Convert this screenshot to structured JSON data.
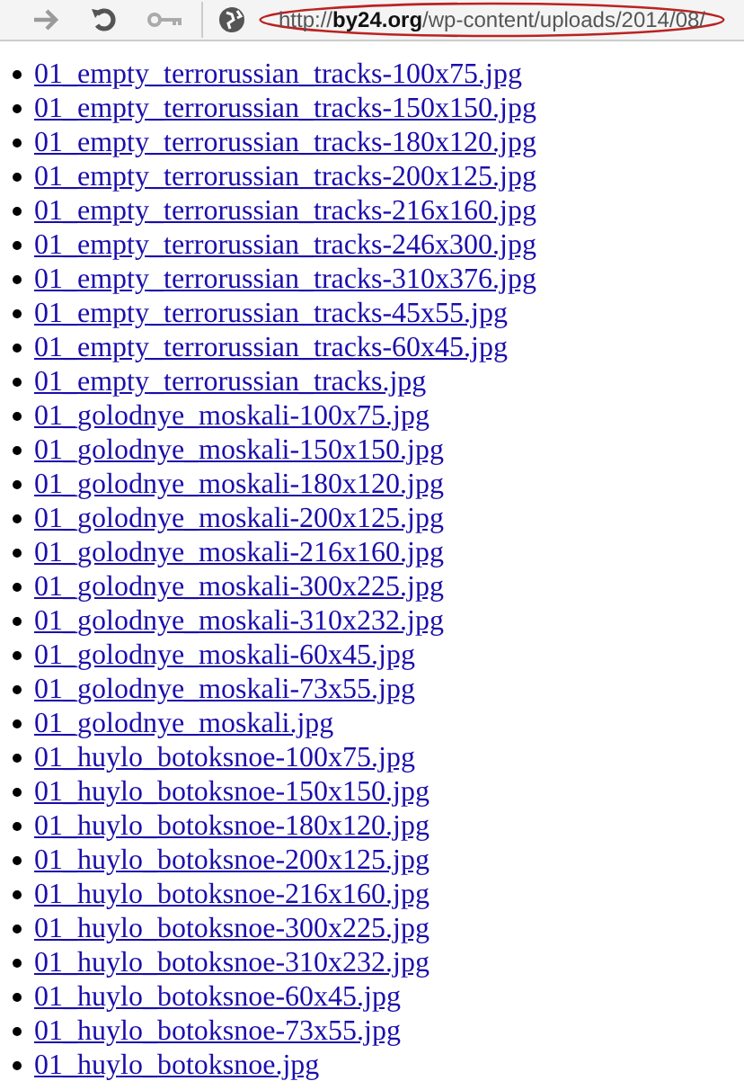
{
  "address_bar": {
    "url": "http://**by24.org**/wp-content/uploads/2014/08/",
    "highlighted": true
  },
  "files": [
    "01_empty_terrorussian_tracks-100x75.jpg",
    "01_empty_terrorussian_tracks-150x150.jpg",
    "01_empty_terrorussian_tracks-180x120.jpg",
    "01_empty_terrorussian_tracks-200x125.jpg",
    "01_empty_terrorussian_tracks-216x160.jpg",
    "01_empty_terrorussian_tracks-246x300.jpg",
    "01_empty_terrorussian_tracks-310x376.jpg",
    "01_empty_terrorussian_tracks-45x55.jpg",
    "01_empty_terrorussian_tracks-60x45.jpg",
    "01_empty_terrorussian_tracks.jpg",
    "01_golodnye_moskali-100x75.jpg",
    "01_golodnye_moskali-150x150.jpg",
    "01_golodnye_moskali-180x120.jpg",
    "01_golodnye_moskali-200x125.jpg",
    "01_golodnye_moskali-216x160.jpg",
    "01_golodnye_moskali-300x225.jpg",
    "01_golodnye_moskali-310x232.jpg",
    "01_golodnye_moskali-60x45.jpg",
    "01_golodnye_moskali-73x55.jpg",
    "01_golodnye_moskali.jpg",
    "01_huylo_botoksnoe-100x75.jpg",
    "01_huylo_botoksnoe-150x150.jpg",
    "01_huylo_botoksnoe-180x120.jpg",
    "01_huylo_botoksnoe-200x125.jpg",
    "01_huylo_botoksnoe-216x160.jpg",
    "01_huylo_botoksnoe-300x225.jpg",
    "01_huylo_botoksnoe-310x232.jpg",
    "01_huylo_botoksnoe-60x45.jpg",
    "01_huylo_botoksnoe-73x55.jpg",
    "01_huylo_botoksnoe.jpg"
  ]
}
